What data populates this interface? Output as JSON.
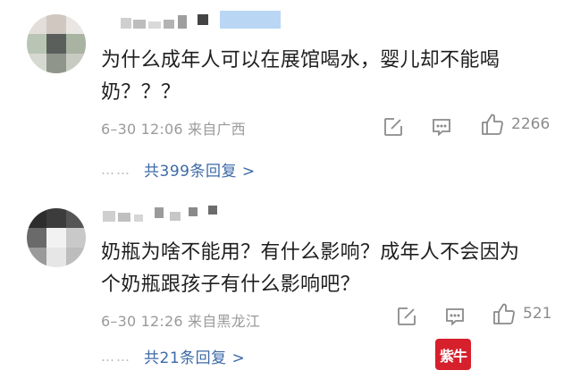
{
  "comments": [
    {
      "text_line1": "为什么成年人可以在展馆喝水，婴儿却不能喝",
      "text_line2": "奶？？？",
      "meta": "6–30 12:06 来自广西",
      "likes": "2266",
      "replies": "共399条回复 >"
    },
    {
      "text_line1": "奶瓶为啥不能用？有什么影响？成年人不会因为",
      "text_line2": "个奶瓶跟孩子有什么影响吧？",
      "meta": "6–30 12:26 来自黑龙江",
      "likes": "521",
      "replies": "共21条回复 >"
    }
  ],
  "dots": "……",
  "icons": {
    "edit": "edit-square-icon",
    "comment": "comment-bubble-icon",
    "like": "thumbs-up-icon"
  },
  "colors": {
    "link": "#3d6aa8",
    "meta": "#9a9a9a",
    "logo_bg": "#d6202c"
  },
  "watermark": "紫牛"
}
